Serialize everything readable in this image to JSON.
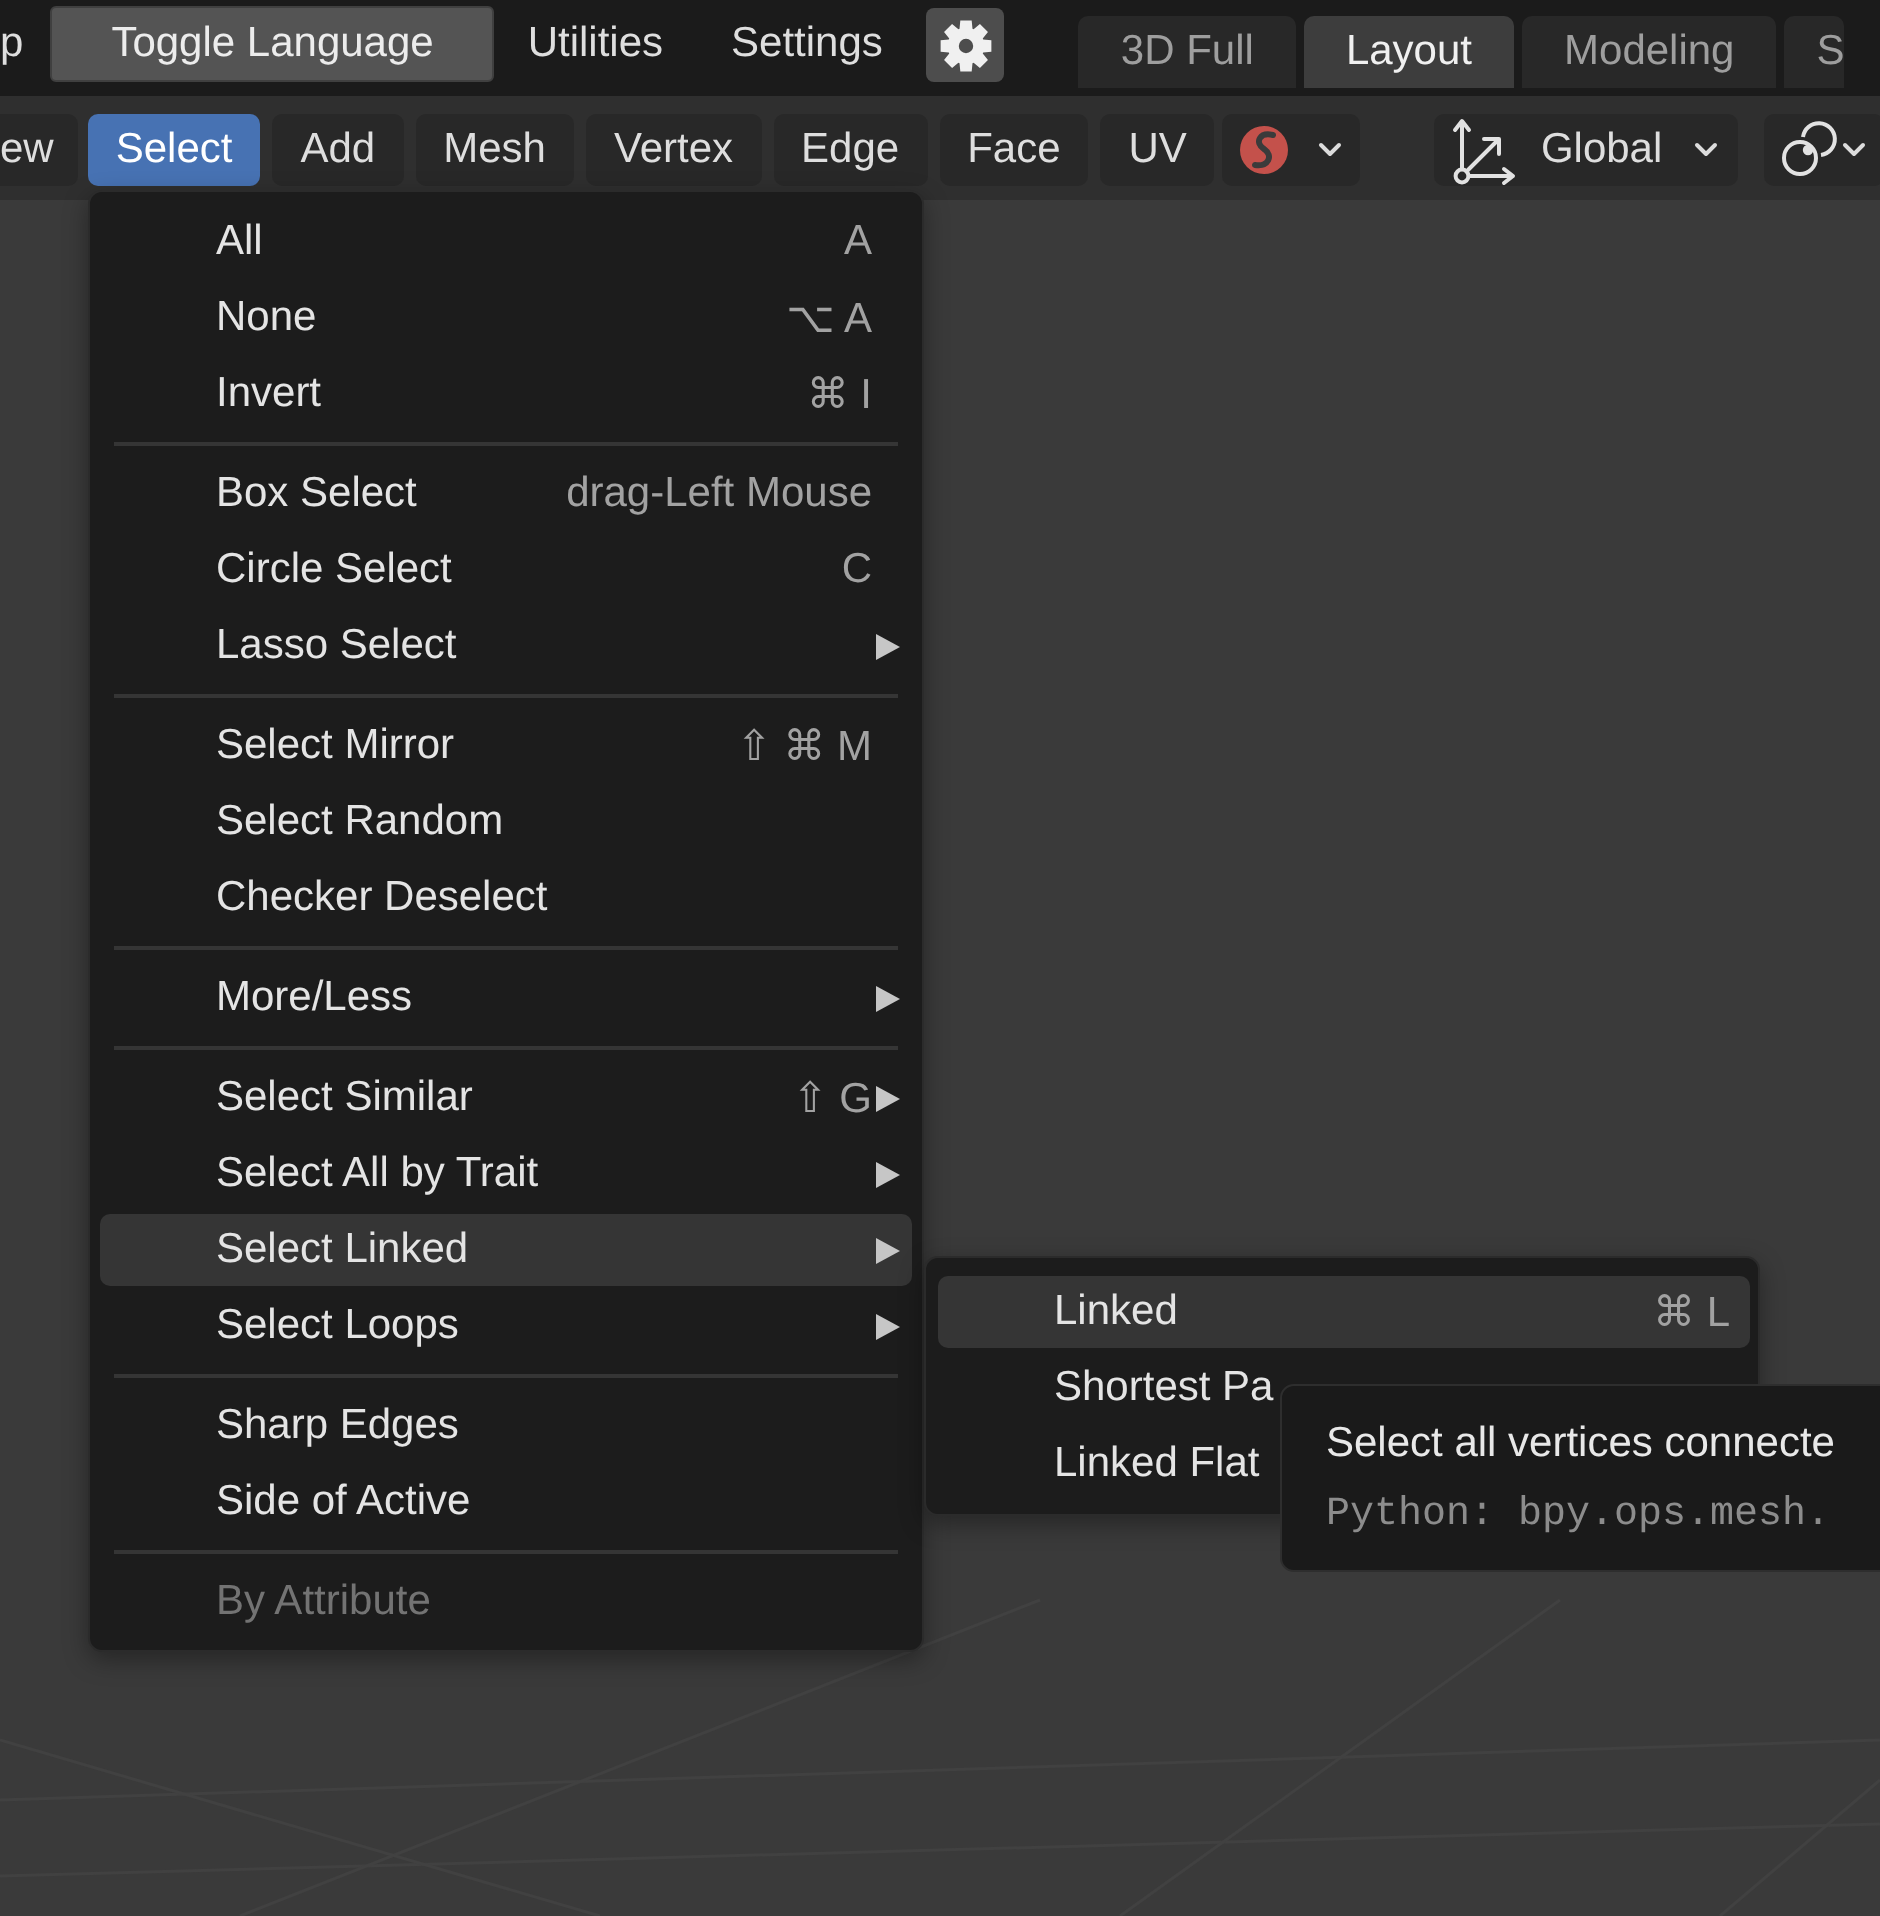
{
  "top_bar": {
    "items": [
      {
        "kind": "menu",
        "label": "p"
      },
      {
        "kind": "button",
        "label": "Toggle Language"
      },
      {
        "kind": "menu",
        "label": "Utilities"
      },
      {
        "kind": "menu",
        "label": "Settings"
      },
      {
        "kind": "icon_button"
      }
    ]
  },
  "workspace_tabs": [
    {
      "label": "3D Full",
      "selected": false
    },
    {
      "label": "Layout",
      "selected": true
    },
    {
      "label": "Modeling",
      "selected": false
    },
    {
      "label": "S",
      "selected": false
    }
  ],
  "header_menus": [
    {
      "label": "ew",
      "selected": false
    },
    {
      "label": "Select",
      "selected": true
    },
    {
      "label": "Add",
      "selected": false
    },
    {
      "label": "Mesh",
      "selected": false
    },
    {
      "label": "Vertex",
      "selected": false
    },
    {
      "label": "Edge",
      "selected": false
    },
    {
      "label": "Face",
      "selected": false
    },
    {
      "label": "UV",
      "selected": false
    }
  ],
  "header_controls": [
    {
      "kind": "addon"
    },
    {
      "kind": "orientation",
      "label": "Global"
    },
    {
      "kind": "pivot"
    }
  ],
  "select_menu": {
    "sections": [
      {
        "items": [
          {
            "label": "All",
            "shortcut": "A",
            "submenu": false,
            "selected": false,
            "disabled": false
          },
          {
            "label": "None",
            "shortcut": "⌥ A",
            "submenu": false,
            "selected": false,
            "disabled": false
          },
          {
            "label": "Invert",
            "shortcut": "⌘ I",
            "submenu": false,
            "selected": false,
            "disabled": false
          }
        ]
      },
      {
        "items": [
          {
            "label": "Box Select",
            "shortcut": "drag-Left Mouse",
            "submenu": false,
            "selected": false,
            "disabled": false
          },
          {
            "label": "Circle Select",
            "shortcut": "C",
            "submenu": false,
            "selected": false,
            "disabled": false
          },
          {
            "label": "Lasso Select",
            "submenu": true,
            "selected": false,
            "disabled": false
          }
        ]
      },
      {
        "items": [
          {
            "label": "Select Mirror",
            "shortcut": "⇧ ⌘ M",
            "submenu": false,
            "selected": false,
            "disabled": false
          },
          {
            "label": "Select Random",
            "submenu": false,
            "selected": false,
            "disabled": false
          },
          {
            "label": "Checker Deselect",
            "submenu": false,
            "selected": false,
            "disabled": false
          }
        ]
      },
      {
        "items": [
          {
            "label": "More/Less",
            "submenu": true,
            "selected": false,
            "disabled": false
          }
        ]
      },
      {
        "items": [
          {
            "label": "Select Similar",
            "shortcut": "⇧ G",
            "submenu": true,
            "selected": false,
            "disabled": false
          },
          {
            "label": "Select All by Trait",
            "submenu": true,
            "selected": false,
            "disabled": false
          },
          {
            "label": "Select Linked",
            "submenu": true,
            "selected": true,
            "disabled": false
          },
          {
            "label": "Select Loops",
            "submenu": true,
            "selected": false,
            "disabled": false
          }
        ]
      },
      {
        "items": [
          {
            "label": "Sharp Edges",
            "submenu": false,
            "selected": false,
            "disabled": false
          },
          {
            "label": "Side of Active",
            "submenu": false,
            "selected": false,
            "disabled": false
          }
        ]
      },
      {
        "items": [
          {
            "label": "By Attribute",
            "submenu": false,
            "selected": false,
            "disabled": true
          }
        ]
      }
    ]
  },
  "linked_submenu": {
    "items": [
      {
        "label": "Linked",
        "shortcut": "⌘ L",
        "selected": true
      },
      {
        "label": "Shortest Pa",
        "selected": false
      },
      {
        "label": "Linked Flat",
        "selected": false
      }
    ]
  },
  "tooltip": {
    "description": "Select all vertices connecte",
    "python": "Python: bpy.ops.mesh."
  }
}
